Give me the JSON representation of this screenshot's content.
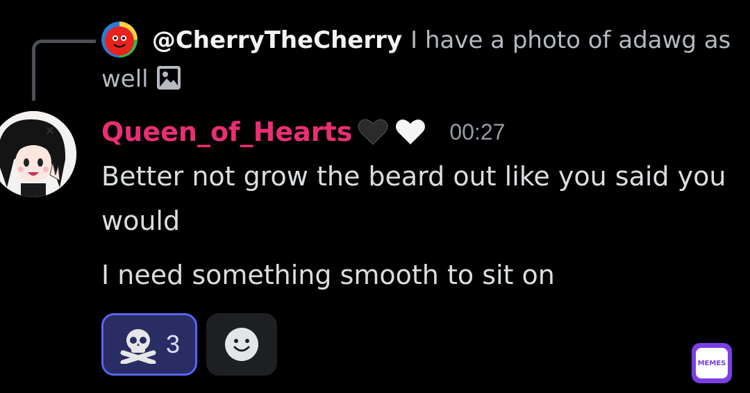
{
  "reply": {
    "username": "@CherryTheCherry",
    "text": "I have a photo of adawg as",
    "text_line2": "well",
    "avatar_icon": "red-ball-avatar",
    "attachment_icon": "image-icon"
  },
  "message": {
    "username": "Queen_of_Hearts",
    "username_color": "#ea2e73",
    "badges": [
      "black-heart-icon",
      "white-heart-icon"
    ],
    "timestamp": "00:27",
    "lines": [
      "Better not grow the beard out like you said you",
      "would",
      "I need something smooth to sit on"
    ]
  },
  "reactions": [
    {
      "emoji": "skull-and-crossbones-icon",
      "count": "3",
      "selected": true
    }
  ],
  "add_reaction_icon": "smiley-face-icon",
  "watermark": {
    "text": "MEMES",
    "accent": "#7a3fe4"
  }
}
